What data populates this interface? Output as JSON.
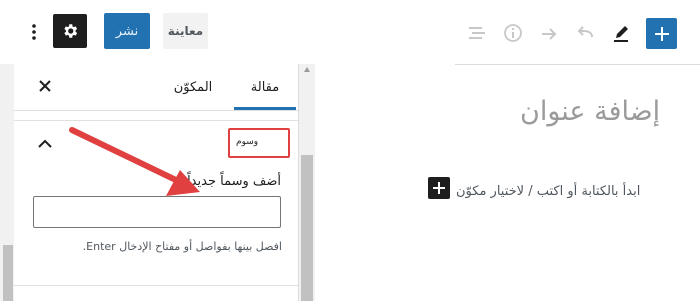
{
  "toolbar": {
    "publish_label": "نشر",
    "preview_label": "معاينة",
    "icons": {
      "more": "kebab-vertical-icon",
      "settings": "gear-icon",
      "outline": "list-view-icon",
      "details": "info-icon",
      "redo": "redo-icon",
      "undo": "undo-icon",
      "tools": "pencil-icon",
      "inserter": "plus-icon"
    }
  },
  "sidebar": {
    "tabs": [
      {
        "label": "مقالة",
        "active": true
      },
      {
        "label": "المكوّن",
        "active": false
      }
    ],
    "close_icon": "close-icon",
    "tags_panel": {
      "title": "وسوم",
      "expanded": true,
      "input_label": "أضف وسماً جديداً",
      "input_value": "",
      "help_text": "افصل بينها بفواصل أو مفتاح الإدخال Enter."
    }
  },
  "editor": {
    "title_placeholder": "إضافة عنوان",
    "paragraph_placeholder": "ابدأ بالكتابة أو اكتب / لاختيار مكوّن"
  },
  "colors": {
    "accent": "#2271b1",
    "dark": "#1e1e1e",
    "annotation": "#e04040"
  }
}
